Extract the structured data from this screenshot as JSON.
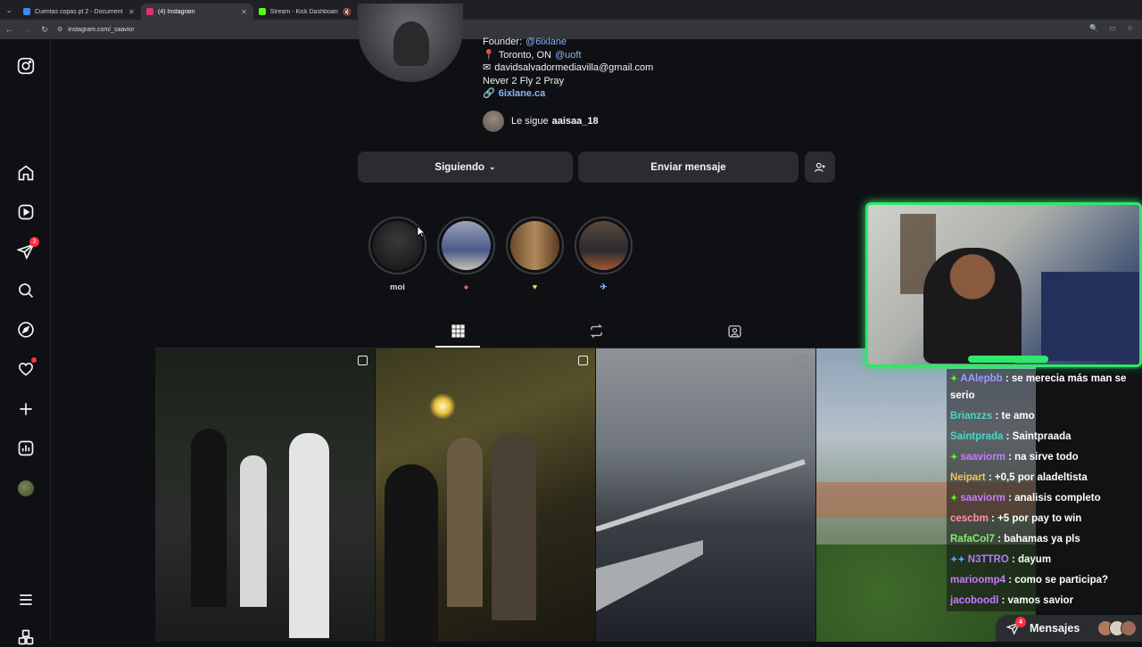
{
  "browser": {
    "tabs": [
      {
        "title": "Cuentas copas pt 2 - Document",
        "favicon_color": "#4285f4",
        "active": false
      },
      {
        "title": "(4) Instagram",
        "favicon_color": "#e1306c",
        "active": true
      },
      {
        "title": "Stream - Kick Dashboard",
        "favicon_color": "#53fc18",
        "active": false
      }
    ],
    "url": "instagram.com/_saavior"
  },
  "sidebar": {
    "notification_count": "3"
  },
  "profile": {
    "bio_founder_label": "Founder:",
    "bio_founder_handle": "@6ixlane",
    "bio_location": "Toronto, ON",
    "bio_location_handle": "@uoft",
    "bio_email": "davidsalvadormediavilla@gmail.com",
    "bio_motto": "Never 2 Fly 2 Pray",
    "bio_link": "6ixlane.ca",
    "followed_by_label": "Le sigue",
    "followed_by_user": "aaisaa_18",
    "follow_button": "Siguiendo",
    "message_button": "Enviar mensaje"
  },
  "stories": [
    {
      "label": "moi",
      "emoji": ""
    },
    {
      "label": "",
      "emoji": "●"
    },
    {
      "label": "",
      "emoji": "♥"
    },
    {
      "label": "",
      "emoji": "✈"
    }
  ],
  "chat": [
    {
      "user": "AAlepbb",
      "text": ": se merecia más man se serio",
      "color": "#9a9aff",
      "badge": "✦"
    },
    {
      "user": "Brianzzs",
      "text": ": te amo",
      "color": "#4ad6c8",
      "badge": ""
    },
    {
      "user": "Saintprada",
      "text": ": Saintpraada",
      "color": "#4ad6c8",
      "badge": ""
    },
    {
      "user": "saaviorm",
      "text": ": na sirve todo",
      "color": "#c67bff",
      "badge": "✦"
    },
    {
      "user": "Neipart",
      "text": ": +0,5 por aladeltista",
      "color": "#f0c45a",
      "badge": ""
    },
    {
      "user": "saaviorm",
      "text": ": analisis completo",
      "color": "#c67bff",
      "badge": "✦"
    },
    {
      "user": "cescbm",
      "text": ": +5 por pay to win",
      "color": "#ff8fb0",
      "badge": ""
    },
    {
      "user": "RafaCol7",
      "text": ": bahamas ya pls",
      "color": "#7df06a",
      "badge": ""
    },
    {
      "user": "N3TTRO",
      "text": ": dayum",
      "color": "#b27bff",
      "badge": "✦✦"
    },
    {
      "user": "marioomp4",
      "text": ": como se participa?",
      "color": "#c67bff",
      "badge": ""
    },
    {
      "user": "jacoboodl",
      "text": ": vamos savior",
      "color": "#c67bff",
      "badge": ""
    }
  ],
  "messages_bar": {
    "label": "Mensajes",
    "count": "4"
  }
}
